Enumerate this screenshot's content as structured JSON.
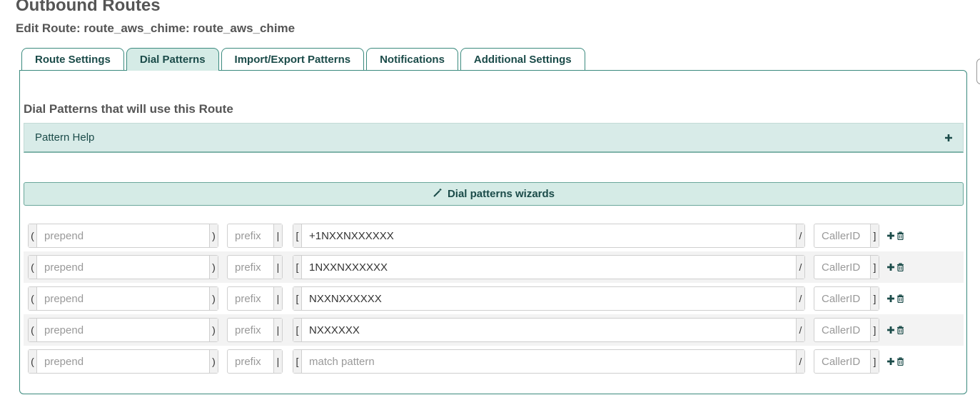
{
  "page": {
    "title": "Outbound Routes",
    "subtitle": "Edit Route: route_aws_chime: route_aws_chime"
  },
  "tabs": [
    {
      "label": "Route Settings",
      "active": false
    },
    {
      "label": "Dial Patterns",
      "active": true
    },
    {
      "label": "Import/Export Patterns",
      "active": false
    },
    {
      "label": "Notifications",
      "active": false
    },
    {
      "label": "Additional Settings",
      "active": false
    }
  ],
  "section": {
    "title": "Dial Patterns that will use this Route"
  },
  "help": {
    "label": "Pattern Help",
    "icon": "plus-icon"
  },
  "wizard": {
    "label": "Dial patterns wizards",
    "icon": "magic-wand-icon"
  },
  "placeholders": {
    "prepend": "prepend",
    "prefix": "prefix",
    "match": "match pattern",
    "callerid": "CallerID"
  },
  "symbols": {
    "open_paren": "(",
    "close_paren": ")",
    "pipe": "|",
    "open_bracket": "[",
    "slash": "/",
    "close_bracket": "]"
  },
  "patterns": [
    {
      "prepend": "",
      "prefix": "",
      "match": "+1NXXNXXXXXX",
      "callerid": ""
    },
    {
      "prepend": "",
      "prefix": "",
      "match": "1NXXNXXXXXX",
      "callerid": ""
    },
    {
      "prepend": "",
      "prefix": "",
      "match": "NXXNXXXXXX",
      "callerid": ""
    },
    {
      "prepend": "",
      "prefix": "",
      "match": "NXXXXXX",
      "callerid": ""
    },
    {
      "prepend": "",
      "prefix": "",
      "match": "",
      "callerid": ""
    }
  ],
  "colors": {
    "accent": "#1b4b49",
    "border": "#3b8a7e",
    "tab_active_bg": "#d5ebe6",
    "accordion_bg": "#d8ebe8"
  }
}
